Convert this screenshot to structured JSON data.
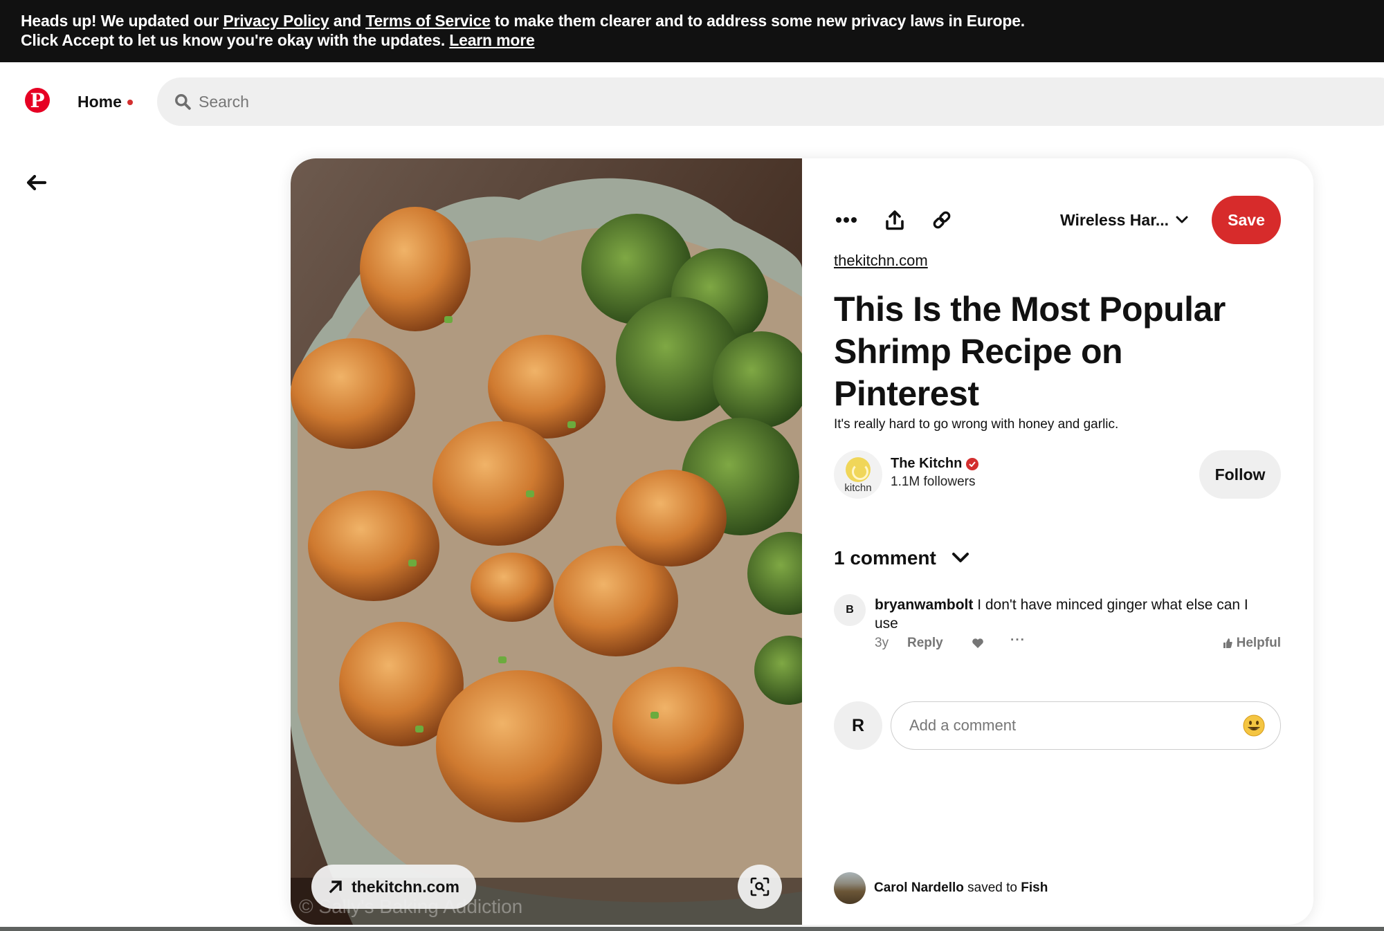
{
  "banner": {
    "prefix": "Heads up! We updated our ",
    "privacy_link": "Privacy Policy",
    "and": " and ",
    "terms_link": "Terms of Service",
    "suffix": " to make them clearer and to address some new privacy laws in Europe.",
    "line2": "Click Accept to let us know you're okay with the updates. ",
    "learn_more": "Learn more"
  },
  "header": {
    "logo_glyph": "P",
    "home_label": "Home",
    "search_placeholder": "Search"
  },
  "pin": {
    "source_pill_label": "thekitchn.com",
    "watermark": "© Sally's Baking Addiction",
    "board_name": "Wireless Har...",
    "save_label": "Save",
    "source_link": "thekitchn.com",
    "title": "This Is the Most Popular Shrimp Recipe on Pinterest",
    "description": "It's really hard to go wrong with honey and garlic.",
    "creator": {
      "name": "The Kitchn",
      "avatar_text": "kitchn",
      "followers": "1.1M followers",
      "follow_label": "Follow",
      "verified": true
    },
    "comments_header": "1 comment",
    "comments": [
      {
        "avatar_letter": "B",
        "user": "bryanwambolt",
        "text": " I don't have minced ginger what else can I use",
        "time": "3y",
        "reply_label": "Reply",
        "more_label": "···",
        "helpful_label": "Helpful"
      }
    ],
    "add_comment": {
      "avatar_letter": "R",
      "placeholder": "Add a comment"
    },
    "activity": {
      "user": "Carol Nardello",
      "action": " saved to ",
      "board": "Fish"
    }
  },
  "colors": {
    "brand_red": "#e60023",
    "save_red": "#d72b2b",
    "banner_bg": "#111111",
    "search_bg": "#efefef"
  }
}
